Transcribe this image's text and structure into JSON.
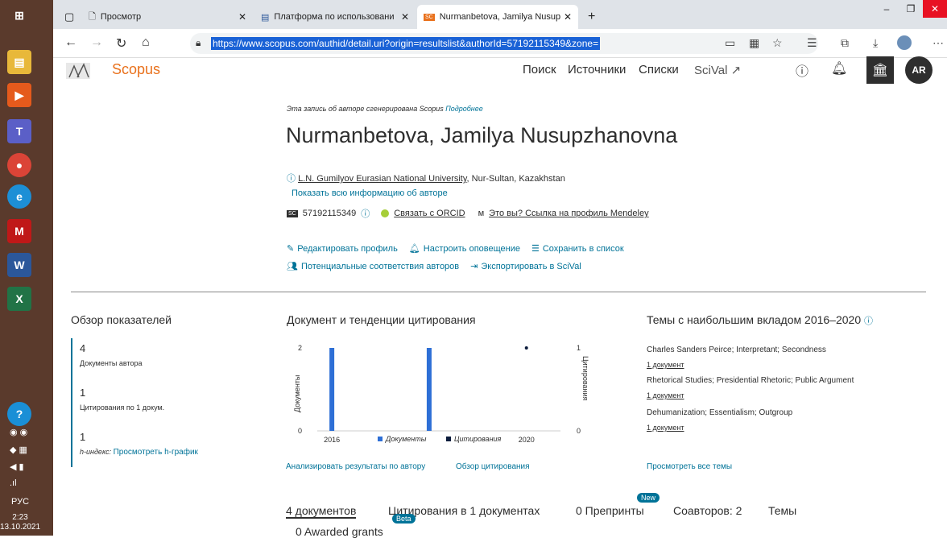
{
  "browser": {
    "tabs": [
      {
        "label": "Просмотр"
      },
      {
        "label": "Платформа по использованию"
      },
      {
        "label": "Nurmanbetova, Jamilya Nusupzh"
      }
    ],
    "url": "https://www.scopus.com/authid/detail.uri?origin=resultslist&authorId=57192115349&zone=",
    "window_controls": [
      "–",
      "❐",
      "✕"
    ]
  },
  "taskbar": {
    "lang": "РУС",
    "time": "2:23",
    "date": "13.10.2021"
  },
  "header": {
    "brand": "Scopus",
    "nav": [
      "Поиск",
      "Источники",
      "Списки",
      "SciVal ↗"
    ],
    "avatar": "AR"
  },
  "author": {
    "generated_note": "Эта запись об авторе сгенерирована Scopus",
    "generated_more": "Подробнее",
    "name": "Nurmanbetova, Jamilya Nusupzhanovna",
    "affiliation_link": "L.N. Gumilyov Eurasian National University",
    "affiliation_rest": ", Nur-Sultan, Kazakhstan",
    "show_all": "Показать всю информацию об авторе",
    "sc_badge": "SC",
    "author_id": "57192115349",
    "orcid": "Связать с ORCID",
    "mendeley": "Это вы? Ссылка на профиль Mendeley"
  },
  "actions": {
    "row1": [
      "Редактировать профиль",
      "Настроить оповещение",
      "Сохранить в список"
    ],
    "row2": [
      "Потенциальные соответствия авторов",
      "Экспортировать в SciVal"
    ]
  },
  "metrics": {
    "title": "Обзор показателей",
    "docs_value": "4",
    "docs_label": "Документы автора",
    "cit_value": "1",
    "cit_label": "Цитирования по 1 докум.",
    "h_value": "1",
    "h_label": "h-индекс:",
    "h_link": "Просмотреть h-график"
  },
  "trends": {
    "title": "Документ и тенденции цитирования",
    "analyze": "Анализировать результаты по автору",
    "citation_overview": "Обзор цитирования"
  },
  "chart_data": {
    "type": "bar",
    "x": [
      "2016",
      "2017",
      "2018",
      "2019",
      "2020"
    ],
    "series": [
      {
        "name": "Документы",
        "values": [
          2,
          0,
          2,
          0,
          0
        ]
      },
      {
        "name": "Цитирования",
        "values": [
          0,
          0,
          0,
          0,
          1
        ]
      }
    ],
    "xlabel": "",
    "ylabel": "Документы",
    "y2label": "Цитирования",
    "ylim": [
      0,
      2
    ],
    "y2lim": [
      0,
      1
    ],
    "x_tick_labels": [
      "2016",
      "2020"
    ],
    "y_ticks": [
      "0",
      "2"
    ],
    "y2_ticks": [
      "0",
      "1"
    ],
    "legend_placement": "bottom",
    "colors": {
      "docs": "#2e6fd6",
      "citations": "#0c1c3c"
    }
  },
  "topics": {
    "title": "Темы с наибольшим вкладом 2016–2020",
    "items": [
      {
        "name": "Charles Sanders Peirce; Interpretant; Secondness",
        "docs": "1 документ"
      },
      {
        "name": "Rhetorical Studies; Presidential Rhetoric; Public Argument",
        "docs": "1 документ"
      },
      {
        "name": "Dehumanization; Essentialism; Outgroup",
        "docs": "1 документ"
      }
    ],
    "view_all": "Просмотреть все темы"
  },
  "bottom_tabs": {
    "docs": "4 документов",
    "citations": "Цитирования в 1 документах",
    "preprints": "0 Препринты",
    "coauthors": "Соавторов: 2",
    "topics": "Темы",
    "awarded": "0 Awarded grants",
    "beta": "Beta",
    "new": "New"
  }
}
